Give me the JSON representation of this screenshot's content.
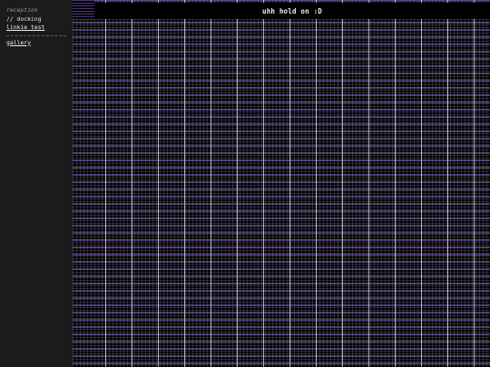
{
  "nav": {
    "section": "reception",
    "current": "// docking",
    "link_linkie": "linkie test",
    "link_gallery": "gallery"
  },
  "main": {
    "loading_text": "uhh hold on :D"
  },
  "colors": {
    "sidebar_bg": "#1b1b1b",
    "content_bg": "#000000",
    "accent_purple": "#785abe"
  }
}
